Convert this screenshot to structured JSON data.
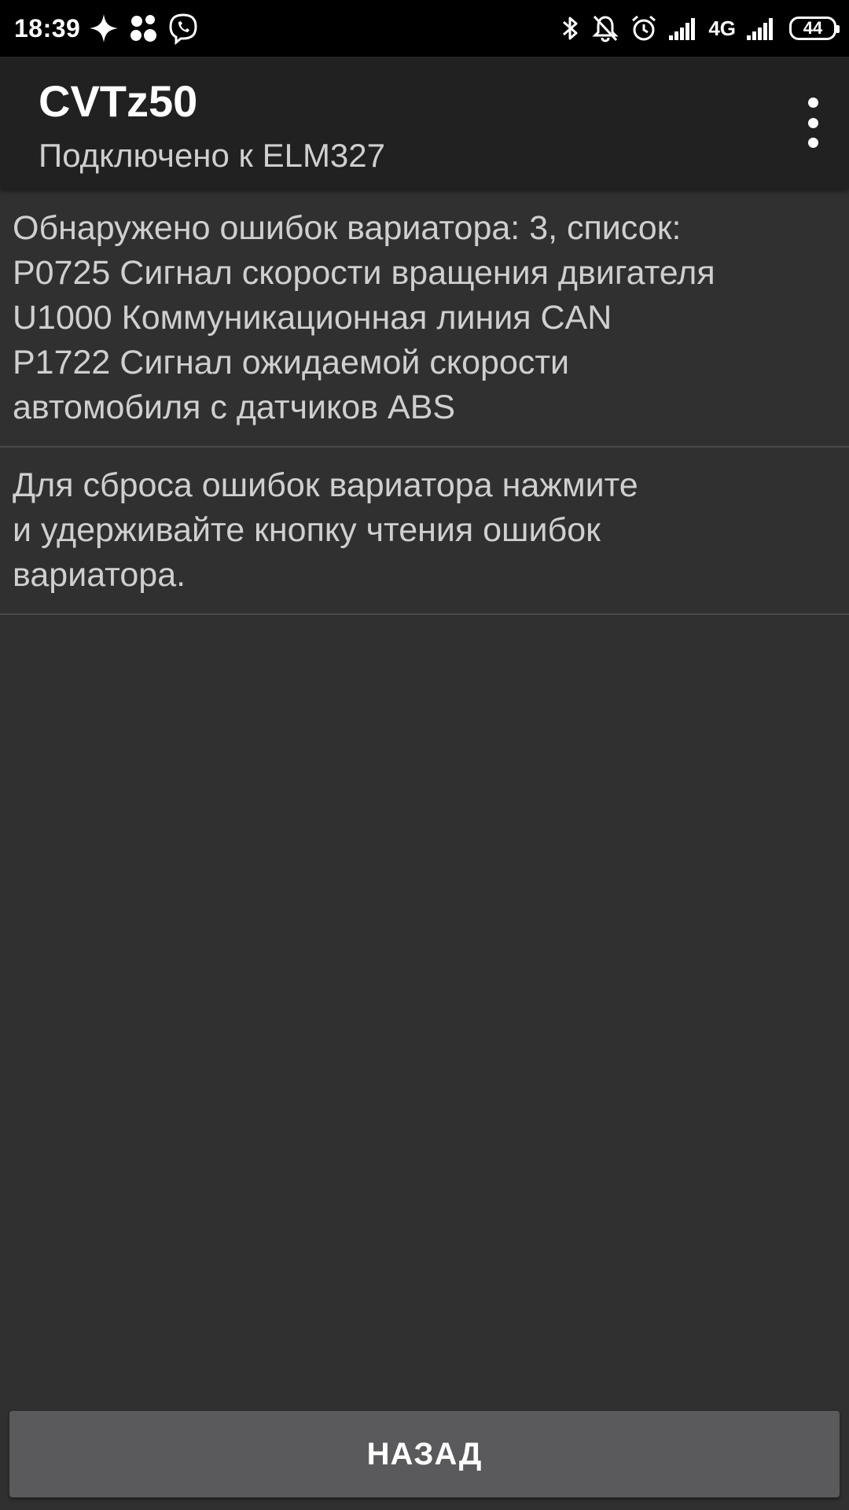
{
  "status_bar": {
    "time": "18:39",
    "left_icons": [
      "sparkle-icon",
      "app-grid-icon",
      "viber-icon"
    ],
    "right_icons": [
      "bluetooth-icon",
      "bell-off-icon",
      "alarm-icon",
      "signal-icon",
      "signal-icon"
    ],
    "network": "4G",
    "battery": "44"
  },
  "app_bar": {
    "title": "CVTz50",
    "subtitle": "Подключено к ELM327",
    "menu_icon": "more-vert-icon"
  },
  "list": {
    "items": [
      {
        "lines": [
          "Обнаружено ошибок вариатора: 3, список:",
          "P0725 Сигнал скорости вращения двигателя",
          "U1000 Коммуникационная линия CAN",
          "P1722 Сигнал ожидаемой скорости",
          "автомобиля с датчиков ABS"
        ]
      },
      {
        "lines": [
          "Для сброса ошибок вариатора нажмите",
          "и удерживайте кнопку чтения ошибок",
          "вариатора."
        ]
      }
    ]
  },
  "footer": {
    "back_label": "НАЗАД"
  },
  "colors": {
    "background": "#303030",
    "app_bar": "#212121",
    "button": "#5a5a5c",
    "divider": "#4a4a4a"
  }
}
